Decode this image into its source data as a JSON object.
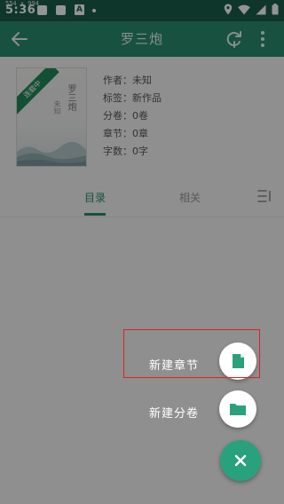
{
  "status_bar": {
    "overlay_text": "554 × 994",
    "time": "5:36",
    "notification_a": "A"
  },
  "app_bar": {
    "title": "罗三炮",
    "back_icon": "arrow-left-icon",
    "refresh_icon": "refresh-icon",
    "more_icon": "more-vert-icon"
  },
  "book": {
    "cover": {
      "ribbon": "连载中",
      "title": "罗三炮",
      "author": "未知"
    },
    "meta": [
      {
        "label": "作者：",
        "value": "未知"
      },
      {
        "label": "标签：",
        "value": "新作品"
      },
      {
        "label": "分卷：",
        "value": "0卷"
      },
      {
        "label": "章节：",
        "value": "0章"
      },
      {
        "label": "字数：",
        "value": "0字"
      }
    ]
  },
  "tabs": [
    {
      "label": "目录",
      "active": true
    },
    {
      "label": "相关",
      "active": false
    }
  ],
  "fab_menu": {
    "items": [
      {
        "label": "新建章节",
        "icon": "file-icon"
      },
      {
        "label": "新建分卷",
        "icon": "folder-icon"
      }
    ],
    "close_icon": "close-icon"
  },
  "colors": {
    "primary": "#2a8c6f",
    "status_bar": "#1a5e4b",
    "fab": "#2aa17d",
    "highlight": "#e02020"
  }
}
